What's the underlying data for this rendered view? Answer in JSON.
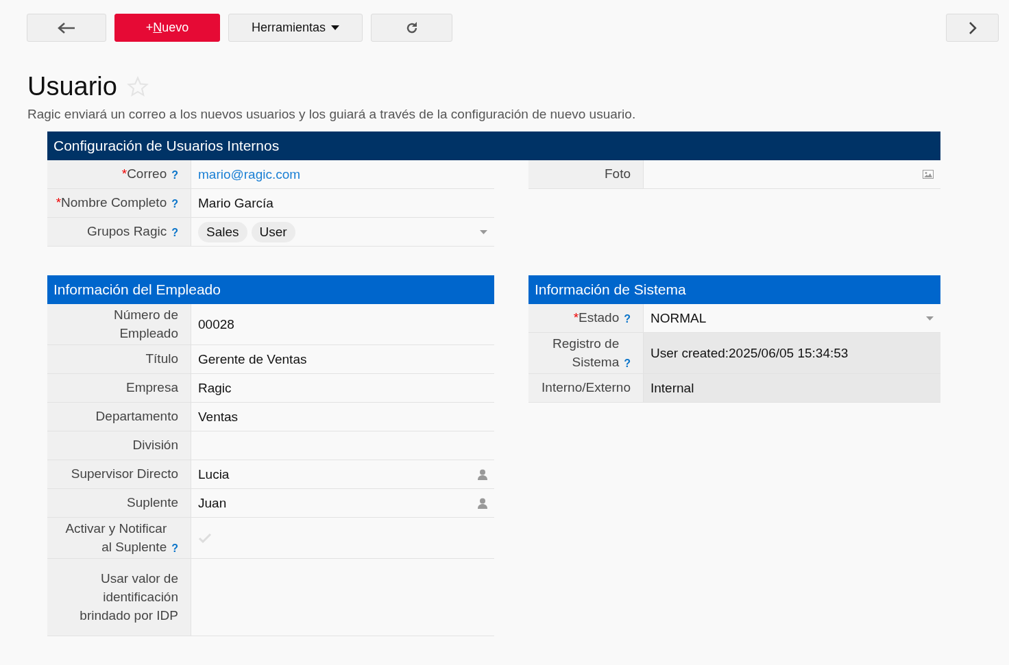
{
  "toolbar": {
    "back": {
      "kind": "back"
    },
    "new_button": {
      "plus": "+",
      "accel": "N",
      "rest": "uevo"
    },
    "tools_button": {
      "label": "Herramientas"
    },
    "next": {
      "kind": "next"
    }
  },
  "page": {
    "title": "Usuario",
    "favorite": false,
    "description": "Ragic enviará un correo a los nuevos usuarios y los guiará a través de la configuración de nuevo usuario."
  },
  "main_section": {
    "title": "Configuración de Usuarios Internos",
    "fields": [
      {
        "label": "Correo",
        "required": "*",
        "help": "?",
        "kind": "email",
        "value": "mario@ragic.com"
      },
      {
        "label": "Nombre Completo",
        "required": "*",
        "help": "?",
        "kind": "text",
        "value": "Mario García"
      },
      {
        "label": "Grupos Ragic",
        "help": "?",
        "kind": "tags",
        "tags": [
          "Sales",
          "User"
        ]
      }
    ],
    "side_fields": [
      {
        "label": "Foto",
        "kind": "photo"
      }
    ]
  },
  "employee_section": {
    "title": "Información del Empleado",
    "fields": [
      {
        "label": "Número de Empleado",
        "kind": "text",
        "value": "00028"
      },
      {
        "label": "Título",
        "kind": "text",
        "value": "Gerente de Ventas"
      },
      {
        "label": "Empresa",
        "kind": "text",
        "value": "Ragic"
      },
      {
        "label": "Departamento",
        "kind": "text",
        "value": "Ventas"
      },
      {
        "label": "División",
        "kind": "text"
      },
      {
        "label": "Supervisor Directo",
        "kind": "user",
        "value": "Lucia"
      },
      {
        "label": "Suplente",
        "kind": "user",
        "value": "Juan"
      },
      {
        "label": "Activar y Notificar al Suplente",
        "help": "?",
        "kind": "checkbox",
        "checked": false
      },
      {
        "label": "Usar valor de identificación brindado por IDP",
        "kind": "tall"
      }
    ]
  },
  "system_section": {
    "title": "Información de Sistema",
    "fields": [
      {
        "label": "Estado",
        "required": "*",
        "help": "?",
        "kind": "select",
        "value": "NORMAL"
      },
      {
        "label": "Registro de Sistema",
        "help": "?",
        "kind": "text",
        "readonly": true,
        "value": "User created:2025/06/05 15:34:53"
      },
      {
        "label": "Interno/Externo",
        "kind": "text",
        "readonly": true,
        "value": "Internal"
      }
    ]
  }
}
